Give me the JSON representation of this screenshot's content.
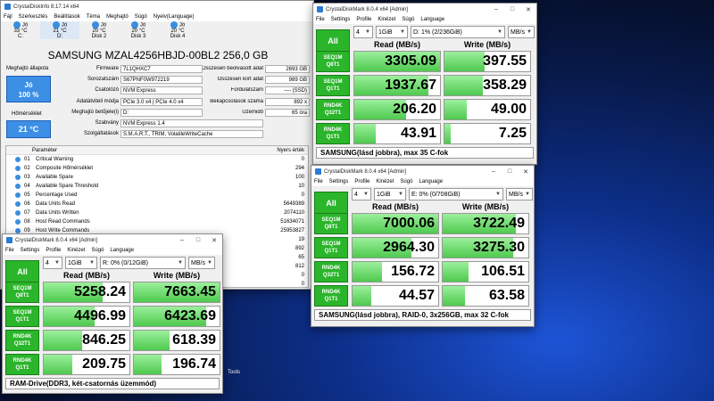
{
  "cdi": {
    "title": "CrystalDiskInfo 8.17.14 x64",
    "menu": [
      "Fájl",
      "Szerkesztés",
      "Beállítások",
      "Téma",
      "Meghajtó",
      "Súgó",
      "Nyelv(Language)"
    ],
    "drives": [
      {
        "status": "Jó",
        "temp": "33 °C",
        "label": "C:"
      },
      {
        "status": "Jó",
        "temp": "21 °C",
        "label": "D:"
      },
      {
        "status": "Jó",
        "temp": "20 °C",
        "label": "Disk 2"
      },
      {
        "status": "Jó",
        "temp": "20 °C",
        "label": "Disk 3"
      },
      {
        "status": "Jó",
        "temp": "20 °C",
        "label": "Disk 4"
      }
    ],
    "model": "SAMSUNG MZAL4256HBJD-00BL2 256,0 GB",
    "health_label": "Meghajtó állapota",
    "health_status": "Jó",
    "health_pct": "100 %",
    "temp_label": "Hőmérséklet",
    "temp_value": "21 °C",
    "left_fields": [
      [
        "Firmware",
        "7L1QHXC7"
      ],
      [
        "Sorozatszám",
        "S67PNF0W972219"
      ],
      [
        "Csatolózó",
        "NVM Express"
      ],
      [
        "Adatátviteli módja",
        "PCIe 3.0 x4 | PCIe 4.0 x4"
      ],
      [
        "Meghajtó betűjele(i)",
        "D:"
      ],
      [
        "Szabvány",
        "NVM Express 1.4"
      ],
      [
        "Szolgáltatások",
        "S.M.A.R.T., TRIM, VolatileWriteCache"
      ]
    ],
    "right_fields": [
      [
        "Összesen beolvasott adat",
        "2693 GB"
      ],
      [
        "Összesen kiírt adat",
        "989 GB"
      ],
      [
        "Fordulatszám",
        "---- (SSD)"
      ],
      [
        "Bekapcsolások száma",
        "892 x"
      ],
      [
        "Üzemidő",
        "65 óra"
      ]
    ],
    "table_header": [
      "ID",
      "Paraméter",
      "Nyers érték"
    ],
    "table_rows": [
      [
        "01",
        "Critical Warning",
        "0"
      ],
      [
        "02",
        "Composite Hőmérséklet",
        "294"
      ],
      [
        "03",
        "Available Spare",
        "100"
      ],
      [
        "04",
        "Available Spare Threshold",
        "10"
      ],
      [
        "05",
        "Percentage Used",
        "0"
      ],
      [
        "06",
        "Data Units Read",
        "5649389"
      ],
      [
        "07",
        "Data Units Written",
        "2074110"
      ],
      [
        "08",
        "Host Read Commands",
        "51634071"
      ],
      [
        "09",
        "Host Write Commands",
        "25953827"
      ]
    ],
    "extra_vals": [
      "19",
      "892",
      "65",
      "812",
      "0",
      "0"
    ]
  },
  "cdm_ram": {
    "title": "CrystalDiskMark 8.0.4 x64 [Admin]",
    "menu": [
      "File",
      "Settings",
      "Profile",
      "Kinézet",
      "Súgó",
      "Language"
    ],
    "count": "4",
    "size": "1GiB",
    "drive": "R: 0% (0/12GiB)",
    "unit": "MB/s",
    "read_h": "Read (MB/s)",
    "write_h": "Write (MB/s)",
    "all": "All",
    "rows": [
      {
        "l1": "SEQ1M",
        "l2": "Q8T1",
        "r": "5258.24",
        "w": "7663.45",
        "rf": 0.69,
        "wf": 1.0
      },
      {
        "l1": "SEQ1M",
        "l2": "Q1T1",
        "r": "4496.99",
        "w": "6423.69",
        "rf": 0.59,
        "wf": 0.84
      },
      {
        "l1": "RND4K",
        "l2": "Q32T1",
        "r": "846.25",
        "w": "618.39",
        "rf": 0.45,
        "wf": 0.42
      },
      {
        "l1": "RND4K",
        "l2": "Q1T1",
        "r": "209.75",
        "w": "196.74",
        "rf": 0.33,
        "wf": 0.32
      }
    ],
    "footer": "RAM-Drive(DDR3, két-csatornás üzemmód)"
  },
  "cdm_single": {
    "title": "CrystalDiskMark 8.0.4 x64 [Admin]",
    "menu": [
      "File",
      "Settings",
      "Profile",
      "Kinézet",
      "Súgó",
      "Language"
    ],
    "count": "4",
    "size": "1GiB",
    "drive": "D: 1% (2/236GiB)",
    "unit": "MB/s",
    "read_h": "Read (MB/s)",
    "write_h": "Write (MB/s)",
    "all": "All",
    "rows": [
      {
        "l1": "SEQ1M",
        "l2": "Q8T1",
        "r": "3305.09",
        "w": "397.55",
        "rf": 1.0,
        "wf": 0.47
      },
      {
        "l1": "SEQ1M",
        "l2": "Q1T1",
        "r": "1937.67",
        "w": "358.29",
        "rf": 0.86,
        "wf": 0.45
      },
      {
        "l1": "RND4K",
        "l2": "Q32T1",
        "r": "206.20",
        "w": "49.00",
        "rf": 0.6,
        "wf": 0.26
      },
      {
        "l1": "RND4K",
        "l2": "Q1T1",
        "r": "43.91",
        "w": "7.25",
        "rf": 0.25,
        "wf": 0.07
      }
    ],
    "footer": "SAMSUNG(lásd jobbra), max 35 C-fok"
  },
  "cdm_raid": {
    "title": "CrystalDiskMark 8.0.4 x64 [Admin]",
    "menu": [
      "File",
      "Settings",
      "Profile",
      "Kinézet",
      "Súgó",
      "Language"
    ],
    "count": "4",
    "size": "1GiB",
    "drive": "E: 0% (0/708GiB)",
    "unit": "MB/s",
    "read_h": "Read (MB/s)",
    "write_h": "Write (MB/s)",
    "all": "All",
    "rows": [
      {
        "l1": "SEQ1M",
        "l2": "Q8T1",
        "r": "7000.06",
        "w": "3722.49",
        "rf": 1.0,
        "wf": 0.85
      },
      {
        "l1": "SEQ1M",
        "l2": "Q1T1",
        "r": "2964.30",
        "w": "3275.30",
        "rf": 0.69,
        "wf": 0.82
      },
      {
        "l1": "RND4K",
        "l2": "Q32T1",
        "r": "156.72",
        "w": "106.51",
        "rf": 0.34,
        "wf": 0.3
      },
      {
        "l1": "RND4K",
        "l2": "Q1T1",
        "r": "44.57",
        "w": "63.58",
        "rf": 0.22,
        "wf": 0.26
      }
    ],
    "footer": "SAMSUNG(lásd jobbra), RAID-0, 3x256GB, max 32 C-fok"
  },
  "desktop": {
    "icon_label": "Tools"
  }
}
